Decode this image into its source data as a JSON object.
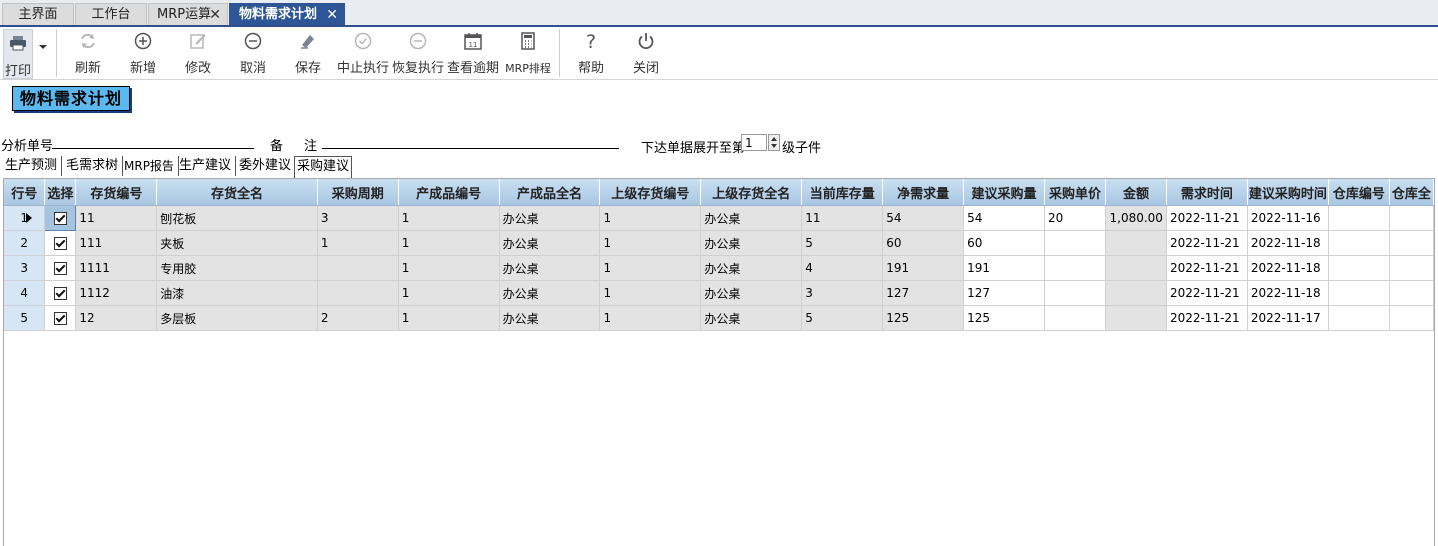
{
  "tabs": [
    {
      "label": "主界面",
      "closable": false
    },
    {
      "label": "工作台",
      "closable": false
    },
    {
      "label": "MRP运算",
      "closable": true
    },
    {
      "label": "物料需求计划",
      "closable": true,
      "active": true
    }
  ],
  "toolbar": {
    "print": "打印",
    "refresh": "刷新",
    "add": "新增",
    "edit": "修改",
    "cancel": "取消",
    "save": "保存",
    "suspend": "中止执行",
    "resume": "恢复执行",
    "overdue": "查看逾期",
    "schedule": "MRP排程",
    "help": "帮助",
    "close": "关闭"
  },
  "page_title": "物料需求计划",
  "form": {
    "analysis_no_label": "分析单号",
    "analysis_no_value": "",
    "remark_label_1": "备",
    "remark_label_2": "注",
    "remark_value": "",
    "expand_prefix": "下达单据展开至第",
    "expand_level": "1",
    "expand_suffix": "级子件"
  },
  "subtabs": [
    "生产预测",
    "毛需求树",
    "MRP报告",
    "生产建议",
    "委外建议",
    "采购建议"
  ],
  "active_subtab": "采购建议",
  "grid": {
    "headers": [
      "行号",
      "选择",
      "存货编号",
      "存货全名",
      "采购周期",
      "产成品编号",
      "产成品全名",
      "上级存货编号",
      "上级存货全名",
      "当前库存量",
      "净需求量",
      "建议采购量",
      "采购单价",
      "金额",
      "需求时间",
      "建议采购时间",
      "仓库编号",
      "仓库全"
    ],
    "rows": [
      {
        "no": "1",
        "code": "11",
        "name": "刨花板",
        "cycle": "3",
        "prod_code": "1",
        "prod_name": "办公桌",
        "parent_code": "1",
        "parent_name": "办公桌",
        "stock": "11",
        "net": "54",
        "suggest": "54",
        "price": "20",
        "amount": "1,080.00",
        "need_date": "2022-11-21",
        "buy_date": "2022-11-16",
        "wh_code": "",
        "wh_name": ""
      },
      {
        "no": "2",
        "code": "111",
        "name": "夹板",
        "cycle": "1",
        "prod_code": "1",
        "prod_name": "办公桌",
        "parent_code": "1",
        "parent_name": "办公桌",
        "stock": "5",
        "net": "60",
        "suggest": "60",
        "price": "",
        "amount": "",
        "need_date": "2022-11-21",
        "buy_date": "2022-11-18",
        "wh_code": "",
        "wh_name": ""
      },
      {
        "no": "3",
        "code": "1111",
        "name": "专用胶",
        "cycle": "",
        "prod_code": "1",
        "prod_name": "办公桌",
        "parent_code": "1",
        "parent_name": "办公桌",
        "stock": "4",
        "net": "191",
        "suggest": "191",
        "price": "",
        "amount": "",
        "need_date": "2022-11-21",
        "buy_date": "2022-11-18",
        "wh_code": "",
        "wh_name": ""
      },
      {
        "no": "4",
        "code": "1112",
        "name": "油漆",
        "cycle": "",
        "prod_code": "1",
        "prod_name": "办公桌",
        "parent_code": "1",
        "parent_name": "办公桌",
        "stock": "3",
        "net": "127",
        "suggest": "127",
        "price": "",
        "amount": "",
        "need_date": "2022-11-21",
        "buy_date": "2022-11-18",
        "wh_code": "",
        "wh_name": ""
      },
      {
        "no": "5",
        "code": "12",
        "name": "多层板",
        "cycle": "2",
        "prod_code": "1",
        "prod_name": "办公桌",
        "parent_code": "1",
        "parent_name": "办公桌",
        "stock": "5",
        "net": "125",
        "suggest": "125",
        "price": "",
        "amount": "",
        "need_date": "2022-11-21",
        "buy_date": "2022-11-17",
        "wh_code": "",
        "wh_name": ""
      }
    ]
  },
  "colors": {
    "accent": "#2e5596",
    "title_bg": "#5cb9ef",
    "header_bg": "#b9d3ea",
    "readonly_bg": "#e3e3e3"
  }
}
